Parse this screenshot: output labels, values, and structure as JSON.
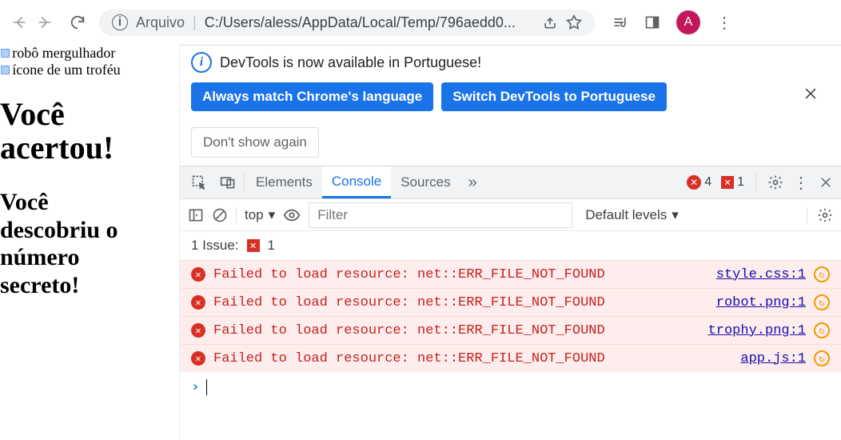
{
  "toolbar": {
    "url_label": "Arquivo",
    "url_path": "C:/Users/aless/AppData/Local/Temp/796aedd0...",
    "avatar_letter": "A"
  },
  "page": {
    "img1_alt": "robô mergulhador",
    "img2_alt": "ícone de um troféu",
    "h1_line1": "Você",
    "h1_line2": "acertou!",
    "h2_line1": "Você",
    "h2_line2": "descobriu o",
    "h2_line3": "número",
    "h2_line4": "secreto!"
  },
  "banner": {
    "message": "DevTools is now available in Portuguese!",
    "btn_always": "Always match Chrome's language",
    "btn_switch": "Switch DevTools to Portuguese",
    "btn_dismiss": "Don't show again"
  },
  "tabs": {
    "elements": "Elements",
    "console": "Console",
    "sources": "Sources",
    "error_count": "4",
    "warn_count": "1"
  },
  "console_toolbar": {
    "context": "top",
    "filter_placeholder": "Filter",
    "levels": "Default levels"
  },
  "issues": {
    "label": "1 Issue:",
    "count": "1"
  },
  "errors": [
    {
      "msg": "Failed to load resource: net::ERR_FILE_NOT_FOUND",
      "src": "style.css:1"
    },
    {
      "msg": "Failed to load resource: net::ERR_FILE_NOT_FOUND",
      "src": "robot.png:1"
    },
    {
      "msg": "Failed to load resource: net::ERR_FILE_NOT_FOUND",
      "src": "trophy.png:1"
    },
    {
      "msg": "Failed to load resource: net::ERR_FILE_NOT_FOUND",
      "src": "app.js:1"
    }
  ]
}
